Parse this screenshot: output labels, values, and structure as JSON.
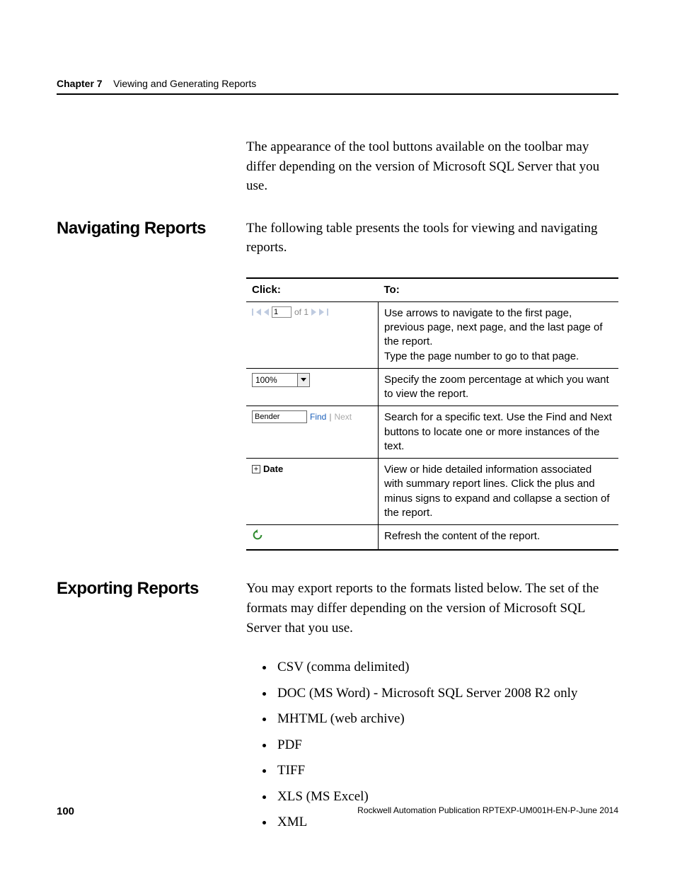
{
  "header": {
    "chapter_label": "Chapter 7",
    "chapter_title": "Viewing and Generating Reports"
  },
  "intro_paragraph": "The appearance of the tool buttons available on the toolbar may differ depending on the version of Microsoft SQL Server that you use.",
  "section_nav": {
    "heading": "Navigating Reports",
    "lead": "The following table presents the tools for viewing and navigating reports.",
    "table": {
      "col_click": "Click:",
      "col_to": "To:",
      "rows": [
        {
          "widget": {
            "page_value": "1",
            "page_total_label": "of 1"
          },
          "desc": "Use arrows to navigate to the first page, previous page, next page, and the last page of the report.\nType the page number to go to that page."
        },
        {
          "widget": {
            "zoom_value": "100%"
          },
          "desc": "Specify the zoom percentage at which you want to view the report."
        },
        {
          "widget": {
            "search_value": "Bender",
            "find_label": "Find",
            "next_label": "Next"
          },
          "desc": "Search for a specific text. Use the Find and Next buttons to locate one or more instances of the text."
        },
        {
          "widget": {
            "expand_label": "Date"
          },
          "desc": "View or hide detailed information associated with summary report lines. Click the plus and minus signs to expand and collapse a section of the report."
        },
        {
          "widget": {
            "icon": "refresh"
          },
          "desc": "Refresh the content of the report."
        }
      ]
    }
  },
  "section_export": {
    "heading": "Exporting Reports",
    "lead": "You may export reports to the formats listed below. The set of the formats may differ depending on the version of Microsoft SQL Server that you use.",
    "formats": [
      "CSV (comma delimited)",
      "DOC (MS Word) - Microsoft SQL Server 2008 R2 only",
      "MHTML (web archive)",
      "PDF",
      "TIFF",
      "XLS (MS Excel)",
      "XML"
    ]
  },
  "footer": {
    "page_number": "100",
    "publication": "Rockwell Automation Publication RPTEXP-UM001H-EN-P-June 2014"
  }
}
